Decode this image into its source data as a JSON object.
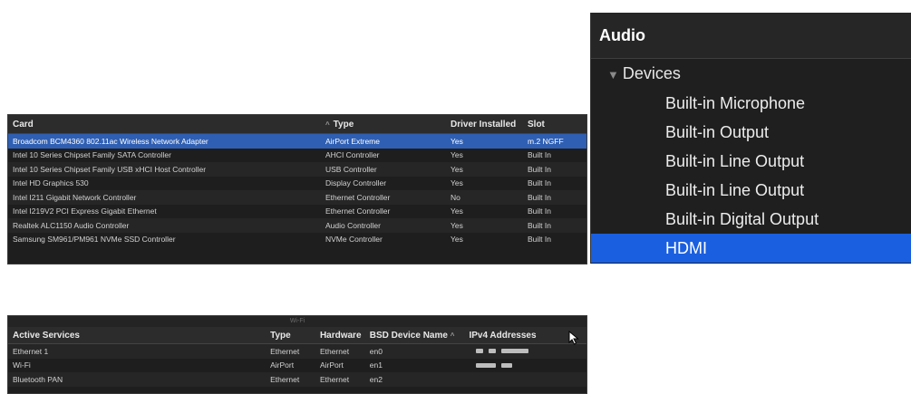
{
  "pci_table": {
    "columns": [
      "Card",
      "Type",
      "Driver Installed",
      "Slot"
    ],
    "sort_indicator": "^",
    "rows": [
      {
        "card": "Broadcom BCM4360 802.11ac Wireless Network Adapter",
        "type": "AirPort Extreme",
        "driver": "Yes",
        "slot": "m.2 NGFF",
        "selected": true
      },
      {
        "card": "Intel 10 Series Chipset Family SATA Controller",
        "type": "AHCI Controller",
        "driver": "Yes",
        "slot": "Built In"
      },
      {
        "card": "Intel 10 Series Chipset Family USB xHCI Host Controller",
        "type": "USB Controller",
        "driver": "Yes",
        "slot": "Built In"
      },
      {
        "card": "Intel HD Graphics 530",
        "type": "Display Controller",
        "driver": "Yes",
        "slot": "Built In"
      },
      {
        "card": "Intel I211 Gigabit Network Controller",
        "type": "Ethernet Controller",
        "driver": "No",
        "slot": "Built In"
      },
      {
        "card": "Intel I219V2 PCI Express Gigabit Ethernet",
        "type": "Ethernet Controller",
        "driver": "Yes",
        "slot": "Built In"
      },
      {
        "card": "Realtek ALC1150 Audio Controller",
        "type": "Audio Controller",
        "driver": "Yes",
        "slot": "Built In"
      },
      {
        "card": "Samsung SM961/PM961 NVMe SSD Controller",
        "type": "NVMe Controller",
        "driver": "Yes",
        "slot": "Built In"
      }
    ]
  },
  "audio": {
    "title": "Audio",
    "group_label": "Devices",
    "items": [
      {
        "label": "Built-in Microphone"
      },
      {
        "label": "Built-in Output"
      },
      {
        "label": "Built-in Line Output"
      },
      {
        "label": "Built-in Line Output"
      },
      {
        "label": "Built-in Digital Output"
      },
      {
        "label": "HDMI",
        "selected": true
      }
    ]
  },
  "net_table": {
    "title": "Wi-Fi",
    "columns": [
      "Active Services",
      "Type",
      "Hardware",
      "BSD Device Name",
      "IPv4 Addresses"
    ],
    "sort_indicator": "^",
    "rows": [
      {
        "service": "Ethernet 1",
        "type": "Ethernet",
        "hardware": "Ethernet",
        "bsd": "en0",
        "ip_blocks": [
          8,
          8,
          30
        ]
      },
      {
        "service": "Wi-Fi",
        "type": "AirPort",
        "hardware": "AirPort",
        "bsd": "en1",
        "ip_blocks": [
          22,
          12
        ]
      },
      {
        "service": "Bluetooth PAN",
        "type": "Ethernet",
        "hardware": "Ethernet",
        "bsd": "en2",
        "ip_blocks": []
      }
    ]
  },
  "colors": {
    "selection_blue": "#1a5fe0",
    "row_selection": "#2f5fb3",
    "background_dark": "#1e1e1e"
  }
}
